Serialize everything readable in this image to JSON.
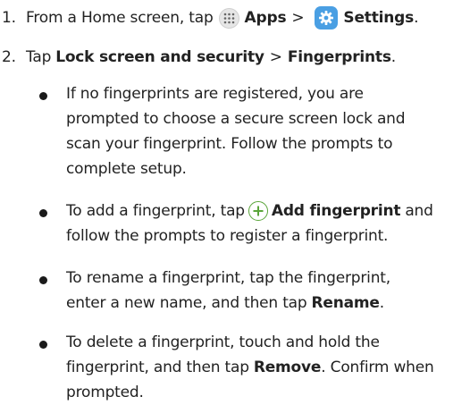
{
  "steps": [
    {
      "number": "1.",
      "text_before": "From a Home screen, tap",
      "apps_icon": "apps-grid-icon",
      "apps_label": "Apps",
      "separator": ">",
      "settings_icon": "gear-icon",
      "settings_label": "Settings",
      "end": "."
    },
    {
      "number": "2.",
      "text_before": "Tap",
      "item1": "Lock screen and security",
      "separator": ">",
      "item2": "Fingerprints",
      "end": "."
    }
  ],
  "bullets": [
    {
      "lines": [
        "If no fingerprints are registered, you are",
        "prompted to choose a secure screen lock and",
        "scan your fingerprint. Follow the prompts to",
        "complete setup."
      ]
    },
    {
      "line1_before": "To add a fingerprint, tap",
      "icon": "plus-circle-icon",
      "bold": "Add fingerprint",
      "line1_after": "and",
      "line2": "follow the prompts to register a fingerprint."
    },
    {
      "line1": "To rename a fingerprint, tap the fingerprint,",
      "line2_before": "enter a new name, and then tap",
      "bold": "Rename",
      "line2_after": "."
    },
    {
      "line1": "To delete a fingerprint, touch and hold the",
      "line2_before": "fingerprint, and then tap",
      "bold": "Remove",
      "line2_after": ". Confirm when",
      "line3": "prompted."
    }
  ],
  "colors": {
    "text": "#222222",
    "settings_icon_bg": "#4a9fe3",
    "plus_icon": "#5aa53a",
    "apps_icon_bg": "#e6e6e6"
  }
}
